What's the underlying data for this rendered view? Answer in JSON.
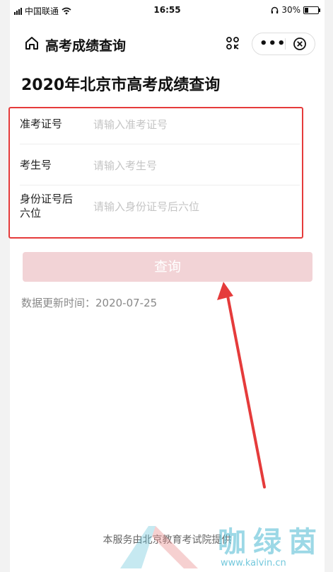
{
  "status_bar": {
    "carrier": "中国联通",
    "time": "16:55",
    "battery": "30%",
    "battery_level": 0.3
  },
  "nav": {
    "title": "高考成绩查询",
    "home_icon": "home-icon",
    "scan_icon": "scan-icon",
    "more_icon": "more-icon",
    "close_icon": "close-circle-icon"
  },
  "page_title": "2020年北京市高考成绩查询",
  "form": {
    "fields": [
      {
        "label": "准考证号",
        "placeholder": "请输入准考证号"
      },
      {
        "label": "考生号",
        "placeholder": "请输入考生号"
      },
      {
        "label": "身份证号后六位",
        "placeholder": "请输入身份证号后六位"
      }
    ]
  },
  "query_button": "查询",
  "update_time": "数据更新时间：2020-07-25",
  "footer": "本服务由北京教育考试院提供",
  "watermark": {
    "text": "咖绿茵",
    "url": "www.kalvin.cn"
  },
  "colors": {
    "annotation": "#e53b3b",
    "button_disabled": "#f2d3d6",
    "watermark": "#5bbfd6"
  }
}
